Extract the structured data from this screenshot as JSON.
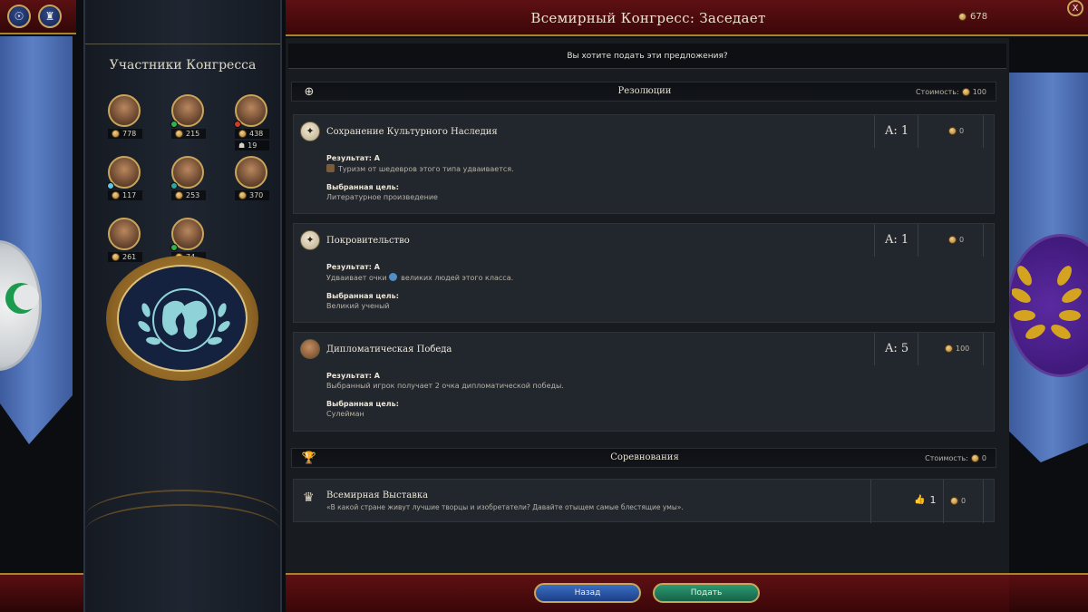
{
  "header": {
    "title": "Всемирный Конгресс: Заседает",
    "currency_value": "678",
    "close_label": "X"
  },
  "members_panel": {
    "title": "Участники Конгресса",
    "members": [
      {
        "value": "778",
        "status": "none"
      },
      {
        "value": "215",
        "status": "green"
      },
      {
        "value": "438",
        "extra": "19",
        "status": "red"
      },
      {
        "value": "117",
        "status": "cyan"
      },
      {
        "value": "253",
        "status": "teal"
      },
      {
        "value": "370",
        "status": "none"
      },
      {
        "value": "261",
        "status": "none"
      },
      {
        "value": "74",
        "status": "green"
      }
    ]
  },
  "prompt": "Вы хотите подать эти предложения?",
  "resolutions_section": {
    "title": "Резолюции",
    "cost_label": "Стоимость:",
    "cost_value": "100"
  },
  "resolutions": [
    {
      "title": "Сохранение Культурного Наследия",
      "vote": "A: 1",
      "cost": "0",
      "result_label": "Результат: A",
      "result_text": "Туризм от шедевров этого типа удваивается.",
      "target_label": "Выбранная цель:",
      "target_text": "Литературное произведение"
    },
    {
      "title": "Покровительство",
      "vote": "A: 1",
      "cost": "0",
      "result_label": "Результат: A",
      "result_text_before": "Удваивает очки",
      "result_text_after": "великих людей этого класса.",
      "target_label": "Выбранная цель:",
      "target_text": "Великий ученый"
    },
    {
      "title": "Дипломатическая Победа",
      "vote": "A: 5",
      "cost": "100",
      "result_label": "Результат: A",
      "result_text": "Выбранный игрок получает 2 очка дипломатической победы.",
      "target_label": "Выбранная цель:",
      "target_text": "Сулейман"
    }
  ],
  "competitions_section": {
    "title": "Соревнования",
    "cost_label": "Стоимость:",
    "cost_value": "0"
  },
  "competition": {
    "title": "Всемирная Выставка",
    "quote": "«В какой стране живут лучшие творцы и изобретатели? Давайте отыщем самые блестящие умы».",
    "votes": "1",
    "cost": "0"
  },
  "footer": {
    "back_label": "Назад",
    "submit_label": "Подать"
  },
  "colors": {
    "header_red": "#5e1013",
    "gold_trim": "#a9832a",
    "back_blue": "#2a56a8",
    "submit_green": "#1f7d5b"
  }
}
